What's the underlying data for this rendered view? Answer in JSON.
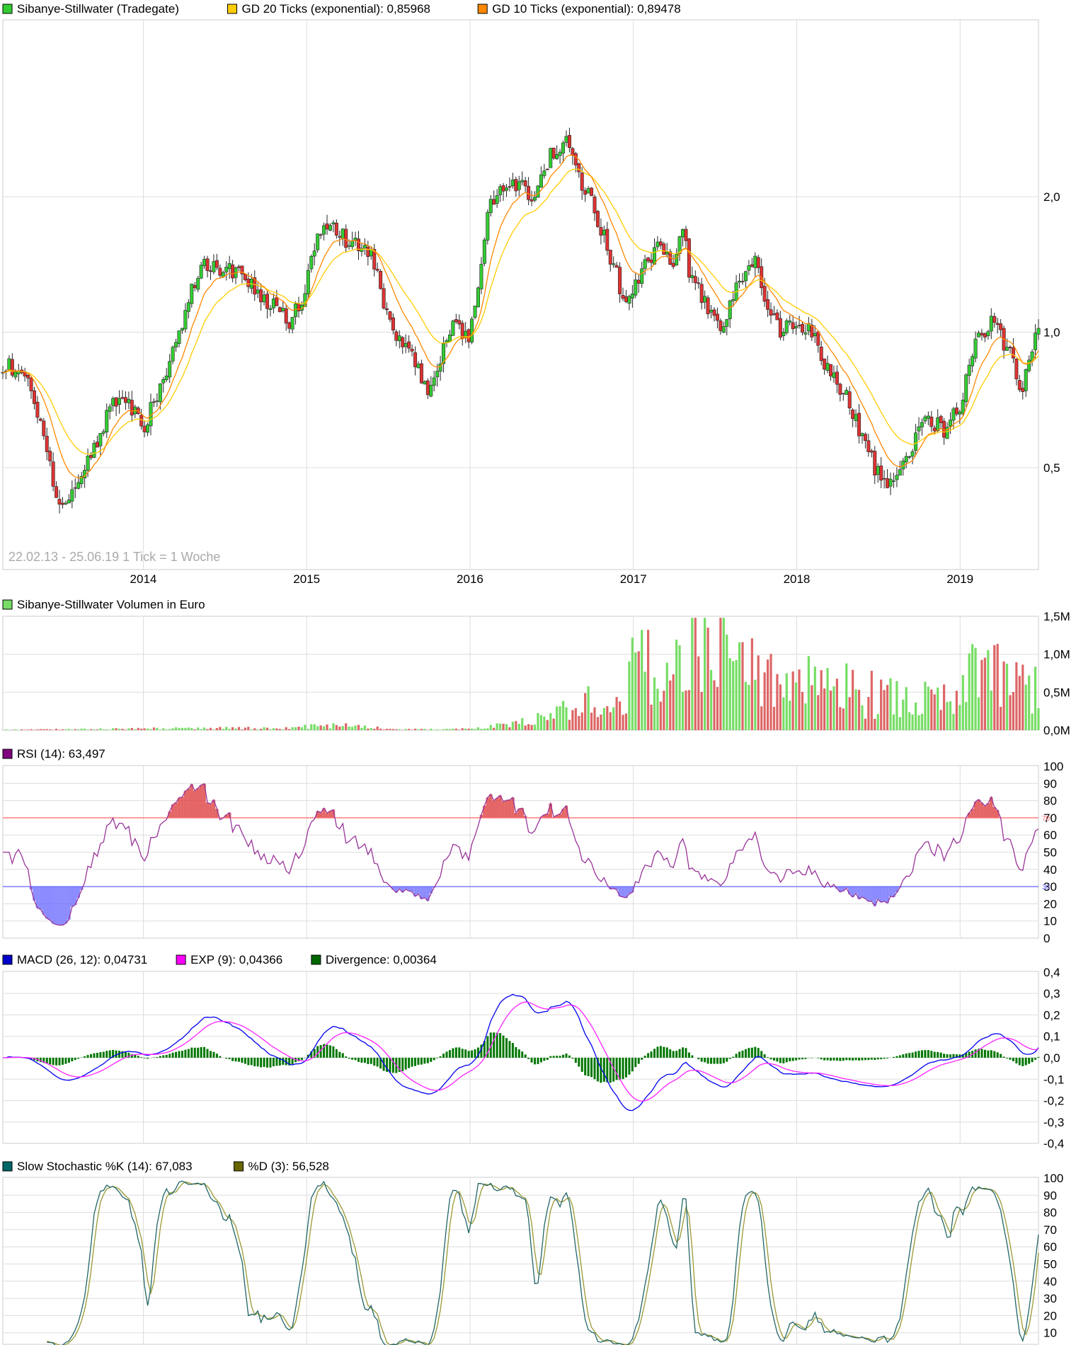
{
  "colors": {
    "up": "#33cc33",
    "down": "#dd3333",
    "ema20": "#ffcc00",
    "ema10": "#ff8800",
    "volume_up": "#77dd66",
    "volume_down": "#dd6666",
    "rsi": "#993399",
    "rsi_upper_line": "#ff6666",
    "rsi_lower_line": "#6666ff",
    "macd": "#0000ee",
    "signal": "#ff22ff",
    "divergence": "#007700",
    "stoch_k": "#226666",
    "stoch_d": "#999933",
    "grid": "#dddddd",
    "frame": "#cccccc"
  },
  "price_panel": {
    "legend": [
      {
        "label": "Sibanye-Stillwater (Tradegate)",
        "color": "#33cc33"
      },
      {
        "label": "GD 20 Ticks (exponential): 0,85968",
        "color": "#ffcc00"
      },
      {
        "label": "GD 10 Ticks (exponential): 0,89478",
        "color": "#ff8800"
      }
    ],
    "watermark": "22.02.13 - 25.06.19    1 Tick = 1 Woche",
    "y_ticks": [
      {
        "v": 2.0,
        "label": "2,0"
      },
      {
        "v": 1.0,
        "label": "1,0"
      },
      {
        "v": 0.5,
        "label": "0,5"
      }
    ],
    "x_labels": [
      {
        "t": 2014.0,
        "label": "2014"
      },
      {
        "t": 2015.0,
        "label": "2015"
      },
      {
        "t": 2016.0,
        "label": "2016"
      },
      {
        "t": 2017.0,
        "label": "2017"
      },
      {
        "t": 2018.0,
        "label": "2018"
      },
      {
        "t": 2019.0,
        "label": "2019"
      }
    ]
  },
  "volume_panel": {
    "legend": [
      {
        "label": "Sibanye-Stillwater Volumen in Euro",
        "color": "#77dd66"
      }
    ],
    "y_ticks": [
      {
        "v": 0,
        "label": "0,0M"
      },
      {
        "v": 0.5,
        "label": "0,5M"
      },
      {
        "v": 1.0,
        "label": "1,0M"
      },
      {
        "v": 1.5,
        "label": "1,5M"
      }
    ]
  },
  "rsi_panel": {
    "legend": [
      {
        "label": "RSI (14): 63,497",
        "color": "#800080"
      }
    ],
    "y_ticks": [
      {
        "v": 0,
        "label": "0"
      },
      {
        "v": 10,
        "label": "10"
      },
      {
        "v": 20,
        "label": "20"
      },
      {
        "v": 30,
        "label": "30"
      },
      {
        "v": 40,
        "label": "40"
      },
      {
        "v": 50,
        "label": "50"
      },
      {
        "v": 60,
        "label": "60"
      },
      {
        "v": 70,
        "label": "70"
      },
      {
        "v": 80,
        "label": "80"
      },
      {
        "v": 90,
        "label": "90"
      },
      {
        "v": 100,
        "label": "100"
      }
    ],
    "upper_line": {
      "v": 70,
      "label": "70"
    },
    "lower_line": {
      "v": 30,
      "label": "30"
    }
  },
  "macd_panel": {
    "legend": [
      {
        "label": "MACD (26, 12): 0,04731",
        "color": "#0000cc"
      },
      {
        "label": "EXP (9): 0,04366",
        "color": "#ff00ff"
      },
      {
        "label": "Divergence: 0,00364",
        "color": "#006600"
      }
    ],
    "y_ticks": [
      {
        "v": 0.4,
        "label": "0,4"
      },
      {
        "v": 0.3,
        "label": "0,3"
      },
      {
        "v": 0.2,
        "label": "0,2"
      },
      {
        "v": 0.1,
        "label": "0,1"
      },
      {
        "v": 0.0,
        "label": "0,0"
      },
      {
        "v": -0.1,
        "label": "-0,1"
      },
      {
        "v": -0.2,
        "label": "-0,2"
      },
      {
        "v": -0.3,
        "label": "-0,3"
      },
      {
        "v": -0.4,
        "label": "-0,4"
      }
    ]
  },
  "stoch_panel": {
    "legend": [
      {
        "label": "Slow Stochastic %K (14): 67,083",
        "color": "#006666"
      },
      {
        "label": "%D (3): 56,528",
        "color": "#666600"
      }
    ],
    "y_ticks": [
      {
        "v": 0,
        "label": "0"
      },
      {
        "v": 10,
        "label": "10"
      },
      {
        "v": 20,
        "label": "20"
      },
      {
        "v": 30,
        "label": "30"
      },
      {
        "v": 40,
        "label": "40"
      },
      {
        "v": 50,
        "label": "50"
      },
      {
        "v": 60,
        "label": "60"
      },
      {
        "v": 70,
        "label": "70"
      },
      {
        "v": 80,
        "label": "80"
      },
      {
        "v": 90,
        "label": "90"
      },
      {
        "v": 100,
        "label": "100"
      }
    ]
  },
  "chart_data": {
    "type": "line",
    "title": "Sibanye-Stillwater (Tradegate)",
    "period": "22.02.13 - 25.06.19",
    "interval": "1 Tick = 1 Woche",
    "y_scale": "log",
    "price_anchors": [
      [
        2013.14,
        0.85
      ],
      [
        2013.3,
        0.8
      ],
      [
        2013.4,
        0.55
      ],
      [
        2013.48,
        0.4
      ],
      [
        2013.6,
        0.45
      ],
      [
        2013.7,
        0.55
      ],
      [
        2013.8,
        0.68
      ],
      [
        2013.9,
        0.72
      ],
      [
        2014.0,
        0.6
      ],
      [
        2014.1,
        0.75
      ],
      [
        2014.2,
        0.95
      ],
      [
        2014.3,
        1.25
      ],
      [
        2014.38,
        1.42
      ],
      [
        2014.5,
        1.35
      ],
      [
        2014.6,
        1.4
      ],
      [
        2014.7,
        1.2
      ],
      [
        2014.8,
        1.15
      ],
      [
        2014.9,
        1.05
      ],
      [
        2015.0,
        1.25
      ],
      [
        2015.05,
        1.6
      ],
      [
        2015.15,
        1.7
      ],
      [
        2015.25,
        1.6
      ],
      [
        2015.4,
        1.5
      ],
      [
        2015.5,
        1.05
      ],
      [
        2015.6,
        0.95
      ],
      [
        2015.7,
        0.8
      ],
      [
        2015.75,
        0.72
      ],
      [
        2015.8,
        0.82
      ],
      [
        2015.85,
        0.95
      ],
      [
        2015.9,
        1.05
      ],
      [
        2016.0,
        0.95
      ],
      [
        2016.05,
        1.3
      ],
      [
        2016.12,
        1.9
      ],
      [
        2016.2,
        2.15
      ],
      [
        2016.32,
        2.1
      ],
      [
        2016.4,
        1.95
      ],
      [
        2016.5,
        2.5
      ],
      [
        2016.58,
        2.7
      ],
      [
        2016.65,
        2.3
      ],
      [
        2016.75,
        1.9
      ],
      [
        2016.85,
        1.5
      ],
      [
        2016.95,
        1.15
      ],
      [
        2017.05,
        1.35
      ],
      [
        2017.15,
        1.55
      ],
      [
        2017.25,
        1.4
      ],
      [
        2017.3,
        1.75
      ],
      [
        2017.35,
        1.3
      ],
      [
        2017.45,
        1.15
      ],
      [
        2017.55,
        1.0
      ],
      [
        2017.65,
        1.3
      ],
      [
        2017.75,
        1.45
      ],
      [
        2017.8,
        1.15
      ],
      [
        2017.9,
        1.0
      ],
      [
        2018.0,
        1.05
      ],
      [
        2018.1,
        1.0
      ],
      [
        2018.2,
        0.8
      ],
      [
        2018.3,
        0.72
      ],
      [
        2018.4,
        0.58
      ],
      [
        2018.5,
        0.48
      ],
      [
        2018.6,
        0.45
      ],
      [
        2018.7,
        0.55
      ],
      [
        2018.8,
        0.65
      ],
      [
        2018.9,
        0.6
      ],
      [
        2019.0,
        0.68
      ],
      [
        2019.1,
        0.95
      ],
      [
        2019.2,
        1.05
      ],
      [
        2019.3,
        0.9
      ],
      [
        2019.38,
        0.75
      ],
      [
        2019.48,
        1.02
      ]
    ],
    "ema20_last": 0.85968,
    "ema10_last": 0.89478,
    "volume_anchors": [
      [
        2013.14,
        0.005
      ],
      [
        2014.0,
        0.02
      ],
      [
        2014.8,
        0.03
      ],
      [
        2015.2,
        0.06
      ],
      [
        2015.6,
        0.01
      ],
      [
        2016.0,
        0.02
      ],
      [
        2016.3,
        0.08
      ],
      [
        2016.55,
        0.25
      ],
      [
        2016.8,
        0.4
      ],
      [
        2016.95,
        0.7
      ],
      [
        2017.1,
        0.9
      ],
      [
        2017.3,
        1.1
      ],
      [
        2017.5,
        1.2
      ],
      [
        2017.7,
        0.85
      ],
      [
        2017.9,
        0.6
      ],
      [
        2018.1,
        0.65
      ],
      [
        2018.3,
        0.55
      ],
      [
        2018.5,
        0.45
      ],
      [
        2018.7,
        0.35
      ],
      [
        2018.85,
        0.4
      ],
      [
        2019.0,
        0.3
      ],
      [
        2019.1,
        1.1
      ],
      [
        2019.25,
        0.6
      ],
      [
        2019.48,
        0.6
      ]
    ],
    "volume_unit": "M EUR",
    "rsi_last": 63.497,
    "macd_last": 0.04731,
    "signal_last": 0.04366,
    "divergence_last": 0.00364,
    "stoch_k_last": 67.083,
    "stoch_d_last": 56.528
  }
}
